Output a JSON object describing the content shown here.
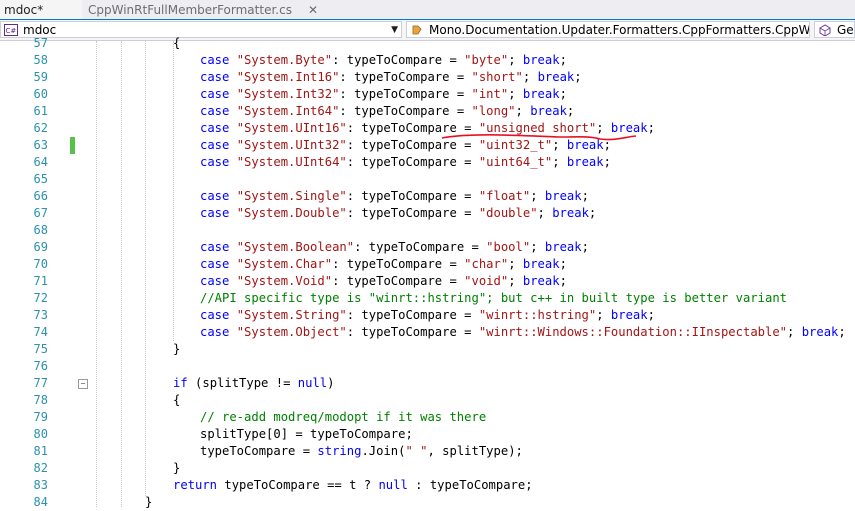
{
  "tabs": [
    {
      "label": "mdoc*",
      "active": true
    },
    {
      "label": "CppWinRtFullMemberFormatter.cs",
      "active": false
    }
  ],
  "nav": {
    "project": "mdoc",
    "type": "Mono.Documentation.Updater.Formatters.CppFormatters.CppW",
    "member": "Get"
  },
  "icons": {
    "close": "close-icon",
    "project": "csharp-project-icon",
    "type": "class-icon",
    "member": "method-icon",
    "dropdown": "chevron-down-icon"
  },
  "colors": {
    "keyword": "#0000ff",
    "string": "#a31515",
    "comment": "#008000",
    "line_number": "#2b91af",
    "change_marker": "#57c14a",
    "annotation": "#e81123"
  },
  "code": [
    {
      "n": "57",
      "t": [
        [
          "",
          "{"
        ]
      ],
      "indent": 0
    },
    {
      "n": "58",
      "t": [
        [
          "kw",
          "case "
        ],
        [
          "str",
          "\"System.Byte\""
        ],
        [
          "",
          ": typeToCompare = "
        ],
        [
          "str",
          "\"byte\""
        ],
        [
          "",
          "; "
        ],
        [
          "kw",
          "break"
        ],
        [
          "",
          ";"
        ]
      ],
      "indent": 1
    },
    {
      "n": "59",
      "t": [
        [
          "kw",
          "case "
        ],
        [
          "str",
          "\"System.Int16\""
        ],
        [
          "",
          ": typeToCompare = "
        ],
        [
          "str",
          "\"short\""
        ],
        [
          "",
          "; "
        ],
        [
          "kw",
          "break"
        ],
        [
          "",
          ";"
        ]
      ],
      "indent": 1
    },
    {
      "n": "60",
      "t": [
        [
          "kw",
          "case "
        ],
        [
          "str",
          "\"System.Int32\""
        ],
        [
          "",
          ": typeToCompare = "
        ],
        [
          "str",
          "\"int\""
        ],
        [
          "",
          "; "
        ],
        [
          "kw",
          "break"
        ],
        [
          "",
          ";"
        ]
      ],
      "indent": 1
    },
    {
      "n": "61",
      "t": [
        [
          "kw",
          "case "
        ],
        [
          "str",
          "\"System.Int64\""
        ],
        [
          "",
          ": typeToCompare = "
        ],
        [
          "str",
          "\"long\""
        ],
        [
          "",
          "; "
        ],
        [
          "kw",
          "break"
        ],
        [
          "",
          ";"
        ]
      ],
      "indent": 1
    },
    {
      "n": "62",
      "t": [
        [
          "kw",
          "case "
        ],
        [
          "str",
          "\"System.UInt16\""
        ],
        [
          "",
          ": typeToCompare = "
        ],
        [
          "str",
          "\"unsigned short\""
        ],
        [
          "",
          "; "
        ],
        [
          "kw",
          "break"
        ],
        [
          "",
          ";"
        ]
      ],
      "indent": 1
    },
    {
      "n": "63",
      "t": [
        [
          "kw",
          "case "
        ],
        [
          "str",
          "\"System.UInt32\""
        ],
        [
          "",
          ": typeToCompare = "
        ],
        [
          "str",
          "\"uint32_t\""
        ],
        [
          "",
          "; "
        ],
        [
          "kw",
          "break"
        ],
        [
          "",
          ";"
        ]
      ],
      "indent": 1
    },
    {
      "n": "64",
      "t": [
        [
          "kw",
          "case "
        ],
        [
          "str",
          "\"System.UInt64\""
        ],
        [
          "",
          ": typeToCompare = "
        ],
        [
          "str",
          "\"uint64_t\""
        ],
        [
          "",
          "; "
        ],
        [
          "kw",
          "break"
        ],
        [
          "",
          ";"
        ]
      ],
      "indent": 1
    },
    {
      "n": "65",
      "t": [],
      "indent": 1
    },
    {
      "n": "66",
      "t": [
        [
          "kw",
          "case "
        ],
        [
          "str",
          "\"System.Single\""
        ],
        [
          "",
          ": typeToCompare = "
        ],
        [
          "str",
          "\"float\""
        ],
        [
          "",
          "; "
        ],
        [
          "kw",
          "break"
        ],
        [
          "",
          ";"
        ]
      ],
      "indent": 1
    },
    {
      "n": "67",
      "t": [
        [
          "kw",
          "case "
        ],
        [
          "str",
          "\"System.Double\""
        ],
        [
          "",
          ": typeToCompare = "
        ],
        [
          "str",
          "\"double\""
        ],
        [
          "",
          "; "
        ],
        [
          "kw",
          "break"
        ],
        [
          "",
          ";"
        ]
      ],
      "indent": 1
    },
    {
      "n": "68",
      "t": [],
      "indent": 1
    },
    {
      "n": "69",
      "t": [
        [
          "kw",
          "case "
        ],
        [
          "str",
          "\"System.Boolean\""
        ],
        [
          "",
          ": typeToCompare = "
        ],
        [
          "str",
          "\"bool\""
        ],
        [
          "",
          "; "
        ],
        [
          "kw",
          "break"
        ],
        [
          "",
          ";"
        ]
      ],
      "indent": 1
    },
    {
      "n": "70",
      "t": [
        [
          "kw",
          "case "
        ],
        [
          "str",
          "\"System.Char\""
        ],
        [
          "",
          ": typeToCompare = "
        ],
        [
          "str",
          "\"char\""
        ],
        [
          "",
          "; "
        ],
        [
          "kw",
          "break"
        ],
        [
          "",
          ";"
        ]
      ],
      "indent": 1
    },
    {
      "n": "71",
      "t": [
        [
          "kw",
          "case "
        ],
        [
          "str",
          "\"System.Void\""
        ],
        [
          "",
          ": typeToCompare = "
        ],
        [
          "str",
          "\"void\""
        ],
        [
          "",
          "; "
        ],
        [
          "kw",
          "break"
        ],
        [
          "",
          ";"
        ]
      ],
      "indent": 1
    },
    {
      "n": "72",
      "t": [
        [
          "cm",
          "//API specific type is \"winrt::hstring\"; but c++ in built type is better variant"
        ]
      ],
      "indent": 1
    },
    {
      "n": "73",
      "t": [
        [
          "kw",
          "case "
        ],
        [
          "str",
          "\"System.String\""
        ],
        [
          "",
          ": typeToCompare = "
        ],
        [
          "str",
          "\"winrt::hstring\""
        ],
        [
          "",
          "; "
        ],
        [
          "kw",
          "break"
        ],
        [
          "",
          ";"
        ]
      ],
      "indent": 1
    },
    {
      "n": "74",
      "t": [
        [
          "kw",
          "case "
        ],
        [
          "str",
          "\"System.Object\""
        ],
        [
          "",
          ": typeToCompare = "
        ],
        [
          "str",
          "\"winrt::Windows::Foundation::IInspectable\""
        ],
        [
          "",
          "; "
        ],
        [
          "kw",
          "break"
        ],
        [
          "",
          ";"
        ]
      ],
      "indent": 1
    },
    {
      "n": "75",
      "t": [
        [
          "",
          "}"
        ]
      ],
      "indent": 0
    },
    {
      "n": "76",
      "t": [],
      "indent": 0
    },
    {
      "n": "77",
      "t": [
        [
          "kw",
          "if"
        ],
        [
          "",
          " (splitType != "
        ],
        [
          "kw",
          "null"
        ],
        [
          "",
          ")"
        ]
      ],
      "indent": 0
    },
    {
      "n": "78",
      "t": [
        [
          "",
          "{"
        ]
      ],
      "indent": 0
    },
    {
      "n": "79",
      "t": [
        [
          "cm",
          "// re-add modreq/modopt if it was there"
        ]
      ],
      "indent": 1
    },
    {
      "n": "80",
      "t": [
        [
          "",
          "splitType[0] = typeToCompare;"
        ]
      ],
      "indent": 1
    },
    {
      "n": "81",
      "t": [
        [
          "",
          "typeToCompare = "
        ],
        [
          "kw",
          "string"
        ],
        [
          "",
          ".Join("
        ],
        [
          "str",
          "\" \""
        ],
        [
          "",
          ", splitType);"
        ]
      ],
      "indent": 1
    },
    {
      "n": "82",
      "t": [
        [
          "",
          "}"
        ]
      ],
      "indent": 0
    },
    {
      "n": "83",
      "t": [
        [
          "kw",
          "return"
        ],
        [
          "",
          " typeToCompare == t ? "
        ],
        [
          "kw",
          "null"
        ],
        [
          "",
          " : typeToCompare;"
        ]
      ],
      "indent": 0
    },
    {
      "n": "84",
      "t": [
        [
          "",
          "}"
        ]
      ],
      "indent": -1
    }
  ]
}
